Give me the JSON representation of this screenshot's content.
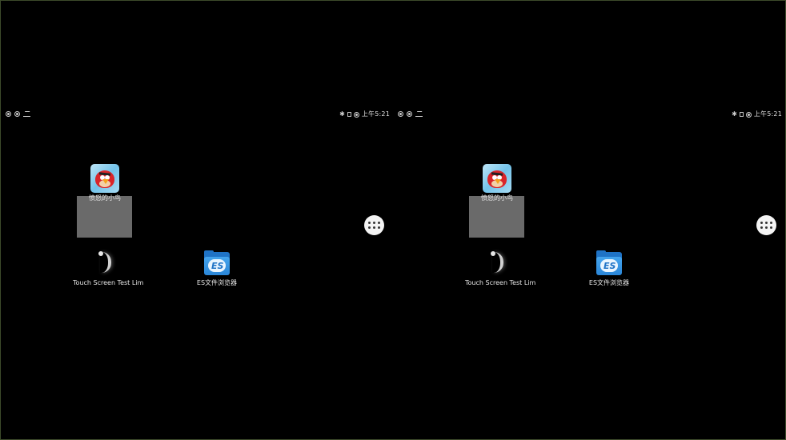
{
  "status_bar": {
    "time": "上午5:21",
    "left_icons": [
      "notification-icon",
      "notification-icon",
      "usb-icon"
    ],
    "right_icons": [
      "bluetooth-icon",
      "sim-icon",
      "signal-icon"
    ]
  },
  "apps": [
    {
      "id": "angry-birds",
      "label": "愤怒的小鸟",
      "icon": "angry-bird-icon"
    },
    {
      "id": "touch-screen-test",
      "label": "Touch Screen Test Lim",
      "icon": "touch-icon"
    },
    {
      "id": "es-file-explorer",
      "label": "ES文件浏览器",
      "icon": "es-folder-icon"
    }
  ],
  "drawer": {
    "icon": "app-drawer-icon"
  },
  "colors": {
    "background": "#000000",
    "highlight": "#6a6a6a",
    "status_text": "#e0e0e0"
  }
}
